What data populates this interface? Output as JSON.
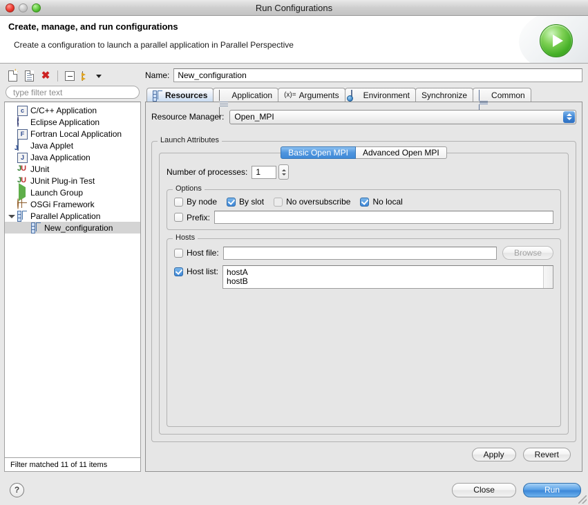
{
  "window": {
    "title": "Run Configurations",
    "traffic_lights": [
      "close-button",
      "minimize-button",
      "zoom-button"
    ]
  },
  "header": {
    "title": "Create, manage, and run configurations",
    "subtitle": "Create a configuration to launch a parallel application in Parallel Perspective",
    "art_icon": "run-play-icon"
  },
  "sidebar": {
    "toolbar": [
      {
        "name": "new-configuration-button",
        "icon": "new-document-icon"
      },
      {
        "name": "duplicate-configuration-button",
        "icon": "copy-document-icon"
      },
      {
        "name": "delete-configuration-button",
        "icon": "red-x-icon"
      },
      {
        "name": "collapse-all-button",
        "icon": "collapse-all-icon"
      },
      {
        "name": "filter-menu-button",
        "icon": "filter-arrows-icon"
      }
    ],
    "filter": {
      "placeholder": "type filter text",
      "value": ""
    },
    "tree": [
      {
        "label": "C/C++ Application",
        "icon": "c-badge-icon",
        "indent": 0,
        "selected": false,
        "twisty": "none"
      },
      {
        "label": "Eclipse Application",
        "icon": "eclipse-sphere-icon",
        "indent": 0,
        "selected": false,
        "twisty": "none"
      },
      {
        "label": "Fortran Local Application",
        "icon": "f-badge-icon",
        "indent": 0,
        "selected": false,
        "twisty": "none"
      },
      {
        "label": "Java Applet",
        "icon": "java-applet-icon",
        "indent": 0,
        "selected": false,
        "twisty": "none"
      },
      {
        "label": "Java Application",
        "icon": "j-badge-icon",
        "indent": 0,
        "selected": false,
        "twisty": "none"
      },
      {
        "label": "JUnit",
        "icon": "junit-icon",
        "indent": 0,
        "selected": false,
        "twisty": "none"
      },
      {
        "label": "JUnit Plug-in Test",
        "icon": "junit-plugin-icon",
        "indent": 0,
        "selected": false,
        "twisty": "none"
      },
      {
        "label": "Launch Group",
        "icon": "launch-group-icon",
        "indent": 0,
        "selected": false,
        "twisty": "none"
      },
      {
        "label": "OSGi Framework",
        "icon": "osgi-icon",
        "indent": 0,
        "selected": false,
        "twisty": "none"
      },
      {
        "label": "Parallel Application",
        "icon": "parallel-app-icon",
        "indent": 0,
        "selected": false,
        "twisty": "open"
      },
      {
        "label": "New_configuration",
        "icon": "parallel-app-icon",
        "indent": 1,
        "selected": true,
        "twisty": "none"
      }
    ],
    "status": "Filter matched 11 of 11 items"
  },
  "main": {
    "name_label": "Name:",
    "name_value": "New_configuration",
    "tabs": [
      {
        "label": "Resources",
        "icon": "parallel-app-icon",
        "active": true
      },
      {
        "label": "Application",
        "icon": "document-icon",
        "active": false
      },
      {
        "label": "Arguments",
        "icon": "variable-xeq-icon",
        "active": false
      },
      {
        "label": "Environment",
        "icon": "environment-icon",
        "active": false
      },
      {
        "label": "Synchronize",
        "icon": "none",
        "active": false
      },
      {
        "label": "Common",
        "icon": "common-icon",
        "active": false
      }
    ],
    "resource_manager": {
      "label": "Resource Manager:",
      "value": "Open_MPI"
    },
    "launch_attributes": {
      "group_label": "Launch Attributes",
      "inner_tabs": [
        {
          "label": "Basic Open MPI",
          "active": true
        },
        {
          "label": "Advanced Open MPI",
          "active": false
        }
      ],
      "num_processes": {
        "label": "Number of processes:",
        "value": "1"
      },
      "options": {
        "group_label": "Options",
        "checkboxes": [
          {
            "label": "By node",
            "checked": false,
            "enabled": true
          },
          {
            "label": "By slot",
            "checked": true,
            "enabled": true
          },
          {
            "label": "No oversubscribe",
            "checked": false,
            "enabled": false
          },
          {
            "label": "No local",
            "checked": true,
            "enabled": true
          }
        ],
        "prefix": {
          "label": "Prefix:",
          "checked": false,
          "value": ""
        }
      },
      "hosts": {
        "group_label": "Hosts",
        "host_file": {
          "label": "Host file:",
          "checked": false,
          "value": "",
          "browse_label": "Browse",
          "browse_enabled": false
        },
        "host_list": {
          "label": "Host list:",
          "checked": true,
          "value": "hostA\nhostB"
        }
      }
    },
    "actions": {
      "apply_label": "Apply",
      "revert_label": "Revert"
    }
  },
  "footer": {
    "help_icon": "help-question-icon",
    "close_label": "Close",
    "run_label": "Run"
  },
  "colors": {
    "accent_blue": "#3d86d6",
    "window_bg": "#e8e8e8",
    "panel_bg": "#e6e6e6",
    "selection_grey": "#d4d4d4",
    "run_green": "#46b028"
  }
}
